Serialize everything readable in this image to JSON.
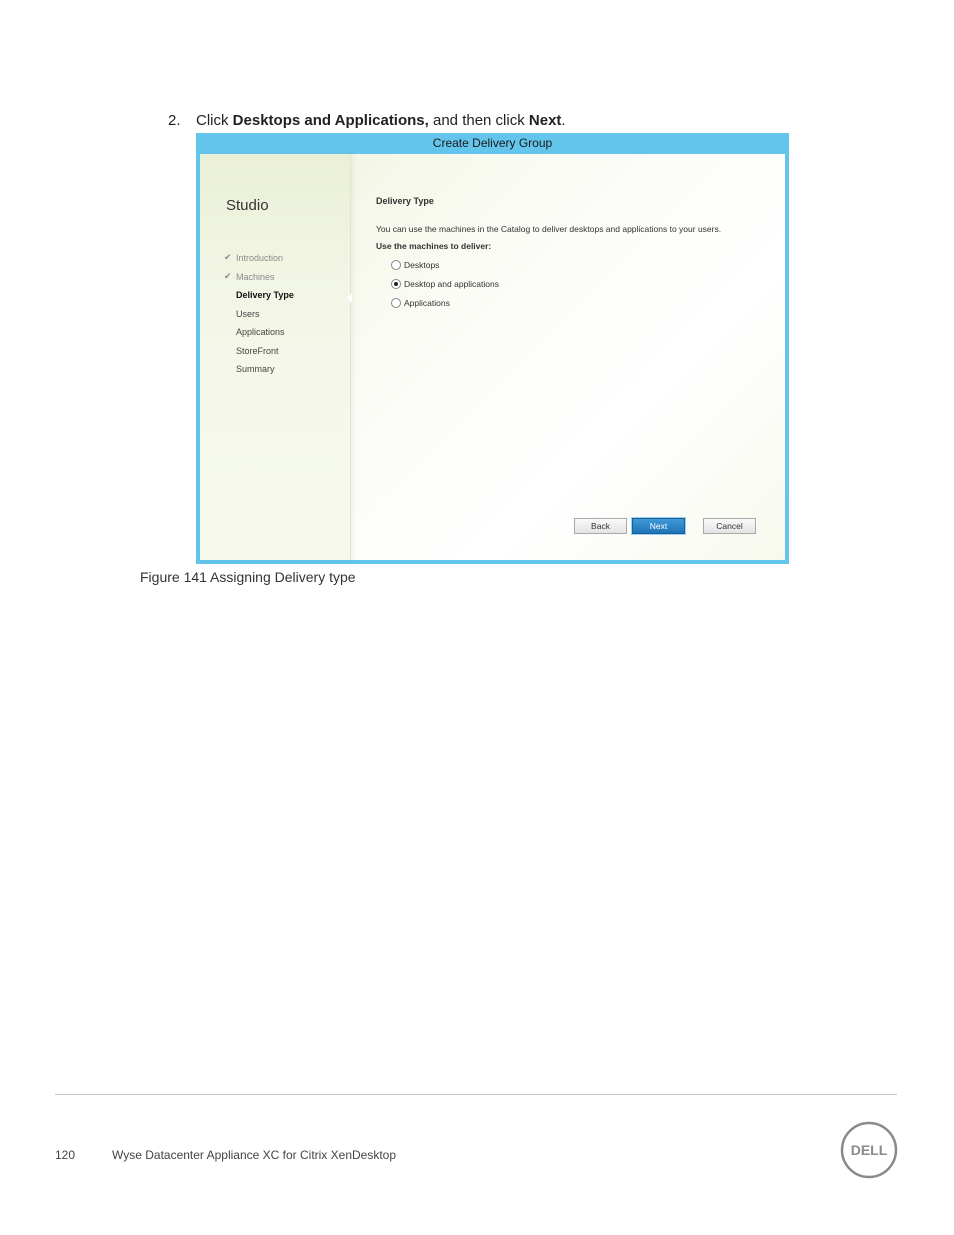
{
  "instruction": {
    "number": "2.",
    "prefix": "Click ",
    "bold1": "Desktops and Applications,",
    "middle": " and then click ",
    "bold2": "Next",
    "suffix": "."
  },
  "dialog": {
    "title": "Create Delivery Group",
    "brand": "Studio",
    "steps": [
      {
        "label": "Introduction",
        "state": "done"
      },
      {
        "label": "Machines",
        "state": "done"
      },
      {
        "label": "Delivery Type",
        "state": "active"
      },
      {
        "label": "Users",
        "state": "pending"
      },
      {
        "label": "Applications",
        "state": "pending"
      },
      {
        "label": "StoreFront",
        "state": "pending"
      },
      {
        "label": "Summary",
        "state": "pending"
      }
    ],
    "check_glyph": "✔",
    "section_title": "Delivery Type",
    "description": "You can use the machines in the Catalog to deliver desktops and applications to your users.",
    "use_label": "Use the machines to deliver:",
    "options": [
      {
        "label": "Desktops",
        "selected": false
      },
      {
        "label": "Desktop and applications",
        "selected": true
      },
      {
        "label": "Applications",
        "selected": false
      }
    ],
    "buttons": {
      "back": "Back",
      "next": "Next",
      "cancel": "Cancel"
    },
    "colors": {
      "frame": "#63c5ec",
      "primary_button": "#2a86c8"
    }
  },
  "caption": "Figure 141 Assigning Delivery type",
  "footer": {
    "page_number": "120",
    "doc_title": "Wyse Datacenter Appliance XC for Citrix XenDesktop",
    "logo_text": "DELL"
  }
}
